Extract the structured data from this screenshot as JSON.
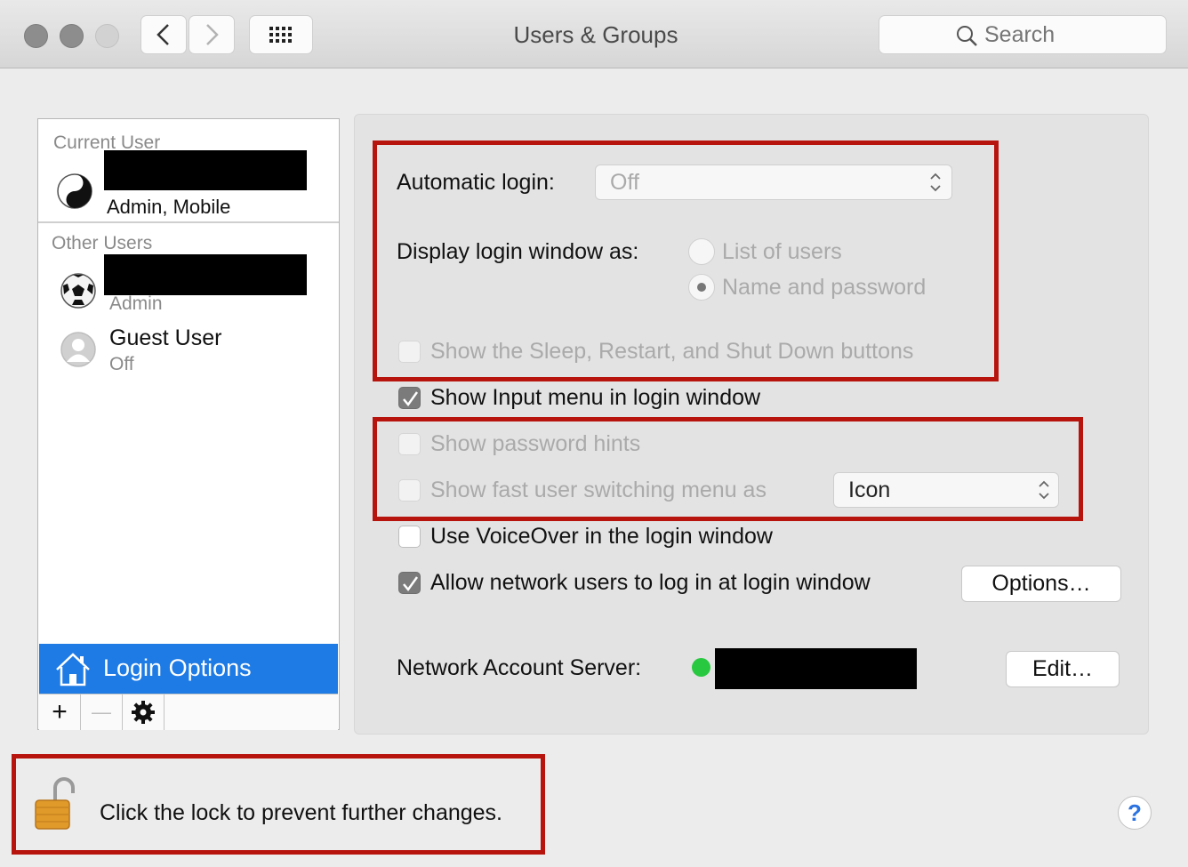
{
  "window": {
    "title": "Users & Groups"
  },
  "search": {
    "placeholder": "Search"
  },
  "sidebar": {
    "current_user_header": "Current User",
    "current_user": {
      "role": "Admin, Mobile"
    },
    "other_users_header": "Other Users",
    "other_user": {
      "role": "Admin"
    },
    "guest": {
      "name": "Guest User",
      "status": "Off"
    },
    "login_options_label": "Login Options",
    "add_label": "+",
    "remove_label": "—"
  },
  "settings": {
    "automatic_login_label": "Automatic login:",
    "automatic_login_value": "Off",
    "display_login_label": "Display login window as:",
    "display_options": [
      "List of users",
      "Name and password"
    ],
    "display_selected": "Name and password",
    "show_sleep_buttons": {
      "label": "Show the Sleep, Restart, and Shut Down buttons",
      "checked": false,
      "enabled": false
    },
    "show_input_menu": {
      "label": "Show Input menu in login window",
      "checked": true,
      "enabled": true
    },
    "show_password_hints": {
      "label": "Show password hints",
      "checked": false,
      "enabled": false
    },
    "show_fast_switching": {
      "label": "Show fast user switching menu as",
      "checked": false,
      "enabled": false,
      "value": "Icon"
    },
    "use_voiceover": {
      "label": "Use VoiceOver in the login window",
      "checked": false,
      "enabled": true
    },
    "allow_network_users": {
      "label": "Allow network users to log in at login window",
      "checked": true,
      "enabled": true
    },
    "options_button": "Options…",
    "network_server_label": "Network Account Server:",
    "network_status_color": "#28c940",
    "edit_button": "Edit…"
  },
  "lock": {
    "text": "Click the lock to prevent further changes."
  },
  "help": {
    "label": "?"
  },
  "colors": {
    "accent": "#1e7be5",
    "highlight_box": "#b8140e"
  }
}
